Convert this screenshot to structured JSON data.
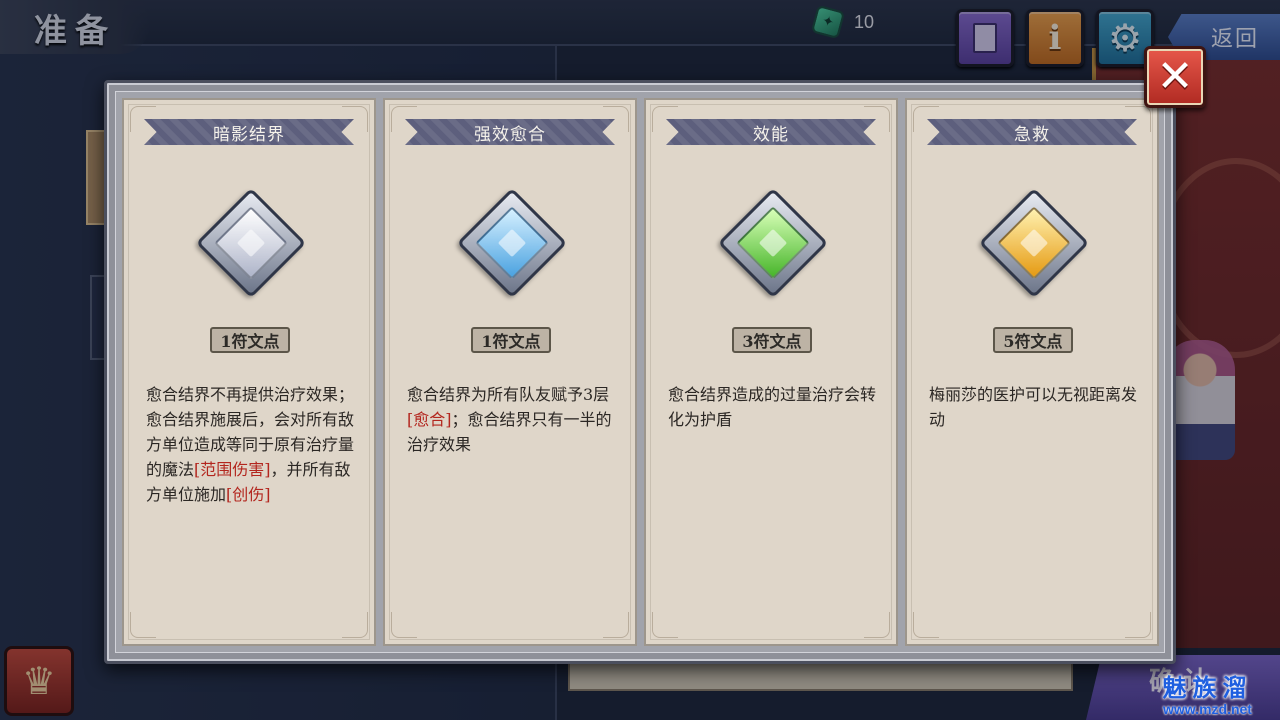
{
  "header": {
    "title": "准备",
    "currency_count": "10",
    "back_label": "返回",
    "confirm_label": "确认"
  },
  "icons": {
    "book": "book-icon",
    "info": "info-icon",
    "gear": "gear-icon",
    "close": "close-icon",
    "trophy": "trophy-icon",
    "currency": "green-gem-icon"
  },
  "watermark": {
    "main": "魅族溜",
    "url": "www.mzd.net"
  },
  "modal": {
    "close_label": "✕",
    "cards": [
      {
        "title": "暗影结界",
        "gem_color": "white",
        "gem_hex": "#e6e8f2",
        "cost": "1符文点",
        "desc_before": "愈合结界不再提供治疗效果；愈合结界施展后，会对所有敌方单位造成等同于原有治疗量的魔法",
        "desc_red1": "[范围伤害]",
        "desc_mid": "，并所有敌方单位施加",
        "desc_red2": "[创伤]",
        "desc_after": ""
      },
      {
        "title": "强效愈合",
        "gem_color": "blue",
        "gem_hex": "#8cc9f2",
        "cost": "1符文点",
        "desc_before": "愈合结界为所有队友赋予3层",
        "desc_red1": "[愈合]",
        "desc_mid": "；愈合结界只有一半的治疗效果",
        "desc_red2": "",
        "desc_after": ""
      },
      {
        "title": "效能",
        "gem_color": "green",
        "gem_hex": "#7ee05a",
        "cost": "3符文点",
        "desc_before": "愈合结界造成的过量治疗会转化为护盾",
        "desc_red1": "",
        "desc_mid": "",
        "desc_red2": "",
        "desc_after": ""
      },
      {
        "title": "急救",
        "gem_color": "gold",
        "gem_hex": "#f7c13c",
        "cost": "5符文点",
        "desc_before": "梅丽莎的医护可以无视距离发动",
        "desc_red1": "",
        "desc_mid": "",
        "desc_red2": "",
        "desc_after": ""
      }
    ]
  }
}
